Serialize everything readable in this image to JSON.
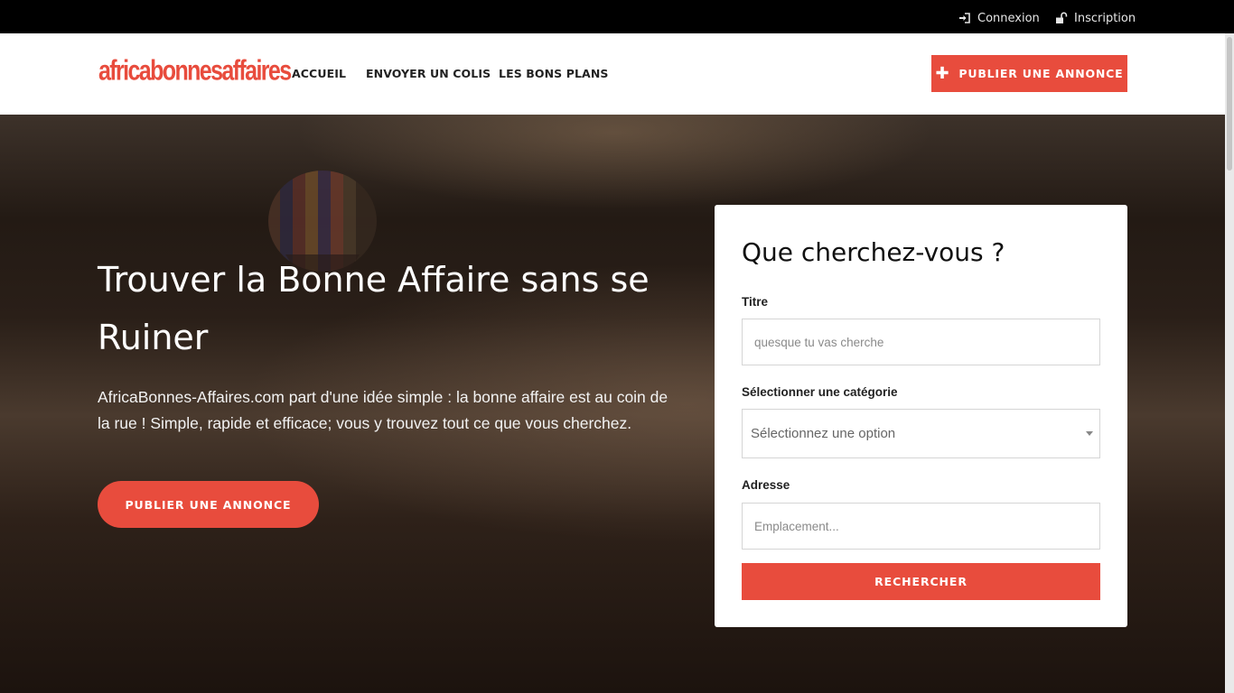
{
  "topbar": {
    "login_label": "Connexion",
    "register_label": "Inscription"
  },
  "header": {
    "logo_text": "africabonnesaffaires",
    "nav": [
      {
        "label": "ACCUEIL"
      },
      {
        "label": "ENVOYER UN COLIS"
      },
      {
        "label": "LES BONS PLANS"
      }
    ],
    "publish_label": "PUBLIER UNE ANNONCE"
  },
  "hero": {
    "title": "Trouver la Bonne Affaire sans se Ruiner",
    "text": "AfricaBonnes-Affaires.com part d'une idée simple : la bonne affaire est au coin de la rue ! Simple, rapide et efficace; vous y trouvez tout ce que vous cherchez.",
    "publish_label": "PUBLIER UNE ANNONCE"
  },
  "search": {
    "title": "Que cherchez-vous ?",
    "titre_label": "Titre",
    "titre_placeholder": "quesque tu vas cherche",
    "category_label": "Sélectionner une catégorie",
    "category_value": "Sélectionnez une option",
    "address_label": "Adresse",
    "address_placeholder": "Emplacement...",
    "submit_label": "RECHERCHER"
  },
  "colors": {
    "accent": "#e84c3d",
    "topbar": "#000000",
    "header": "#ffffff"
  },
  "icons": {
    "login": "sign-in-icon",
    "register": "unlock-icon",
    "publish": "plus-icon",
    "select": "caret-down-icon"
  }
}
